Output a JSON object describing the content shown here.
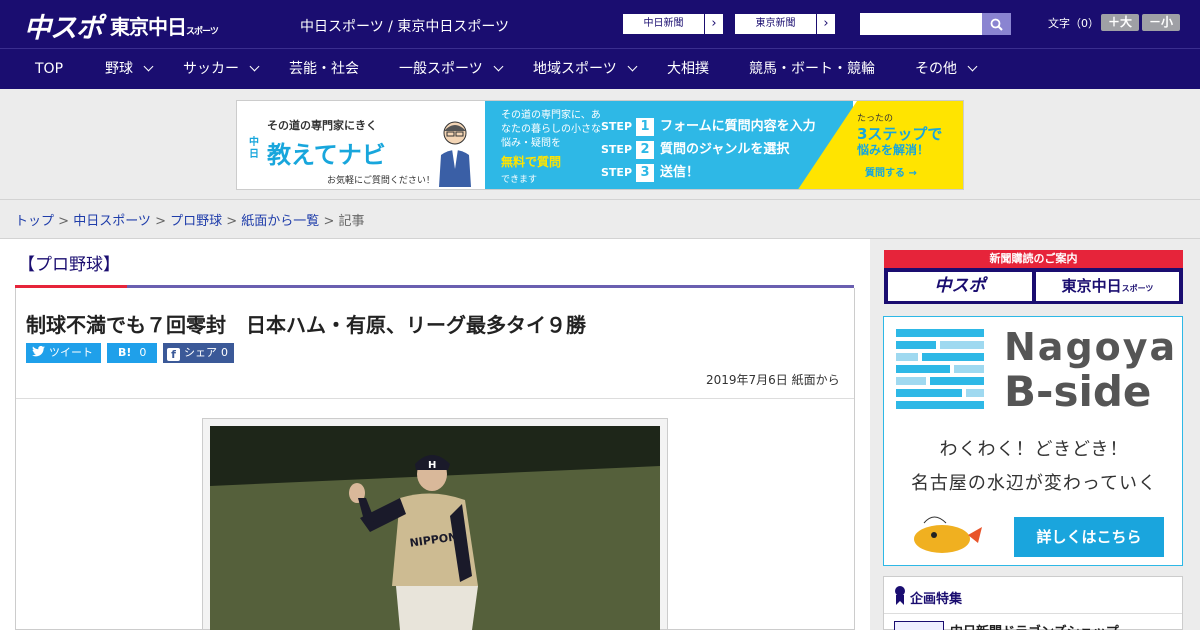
{
  "header": {
    "logo_chuspo": "中スポ",
    "logo_tokyo": "東京中日",
    "logo_tokyo_small": "スポーツ",
    "site_title": "中日スポーツ / 東京中日スポーツ",
    "paper_links": [
      "中日新聞",
      "東京新聞"
    ],
    "search_placeholder": "",
    "font_size_label": "文字（0）",
    "font_plus": "＋大",
    "font_minus": "－小"
  },
  "nav": {
    "items": [
      {
        "label": "TOP",
        "has_menu": false
      },
      {
        "label": "野球",
        "has_menu": true
      },
      {
        "label": "サッカー",
        "has_menu": true
      },
      {
        "label": "芸能・社会",
        "has_menu": false
      },
      {
        "label": "一般スポーツ",
        "has_menu": true
      },
      {
        "label": "地域スポーツ",
        "has_menu": true
      },
      {
        "label": "大相撲",
        "has_menu": false
      },
      {
        "label": "競馬・ボート・競輪",
        "has_menu": false
      },
      {
        "label": "その他",
        "has_menu": true
      }
    ]
  },
  "banner": {
    "tagline": "その道の専門家にきく",
    "brand_prefix": "中日",
    "brand": "教えてナビ",
    "free_note": "お気軽にご質問ください！",
    "desc": "その道の専門家に、あなたの暮らしの小さな悩み・疑問を",
    "free": "無料で質問",
    "dekimasu": "できます",
    "steps": [
      {
        "n": "1",
        "text": "フォームに質問内容を入力"
      },
      {
        "n": "2",
        "text": "質問のジャンルを選択"
      },
      {
        "n": "3",
        "text": "送信！"
      }
    ],
    "step_label": "STEP",
    "right_small": "たったの",
    "right_big": "3ステップで",
    "right_sub": "悩みを解消！",
    "ask": "質問する →"
  },
  "breadcrumb": {
    "items": [
      "トップ",
      "中日スポーツ",
      "プロ野球",
      "紙面から一覧"
    ],
    "current": "記事",
    "sep": " > "
  },
  "article": {
    "category": "【プロ野球】",
    "headline": "制球不満でも７回零封　日本ハム・有原、リーグ最多タイ９勝",
    "tweet": "ツイート",
    "hatena": "B!",
    "hatena_count": "0",
    "share": "シェア",
    "share_count": "0",
    "date": "2019年7月6日 紙面から"
  },
  "sidebar": {
    "subscribe_head": "新聞購読のご案内",
    "subscribe_logos": [
      "中スポ",
      "東京中日"
    ],
    "subscribe_small": "スポーツ",
    "bside_title1": "Nagoya",
    "bside_title2": "B-side",
    "bside_copy1": "わくわく！どきどき！",
    "bside_copy2": "名古屋の水辺が変わっていく",
    "bside_button": "詳しくはこちら",
    "feature_title": "企画特集",
    "feature_item": "中日新聞ドラゴンズショップ"
  },
  "colors": {
    "header": "#1a0d70",
    "accent_red": "#e6243a",
    "link": "#1f3daa",
    "share_blue": "#1fa0ea",
    "bside_blue": "#2eb8e6"
  }
}
